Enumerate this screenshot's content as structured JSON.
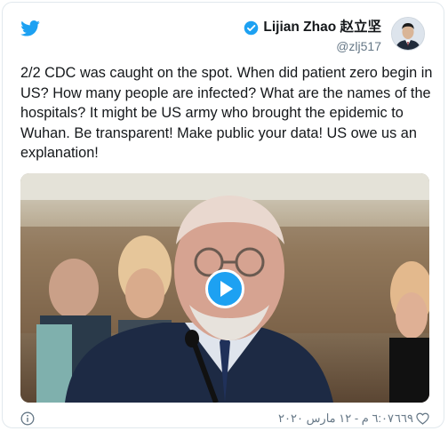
{
  "author": {
    "name": "Lijian Zhao 赵立坚",
    "handle": "@zlj517"
  },
  "tweet": {
    "text": "2/2 CDC was caught on the spot. When did patient zero begin in US? How many people are infected? What are the names of the hospitals? It might be US army who brought the epidemic to Wuhan. Be transparent! Make public your data! US owe us an explanation!"
  },
  "footer": {
    "timestamp": "٦:٠٧ م - ١٢ مارس ٢٠٢٠",
    "like_count": "٦٦٩"
  },
  "icons": {
    "logo": "twitter-bird-icon",
    "verified": "verified-badge-icon",
    "play": "play-icon",
    "info": "info-icon",
    "like": "heart-icon"
  },
  "colors": {
    "brand": "#1da1f2",
    "text": "#14171a",
    "secondary": "#657786"
  }
}
